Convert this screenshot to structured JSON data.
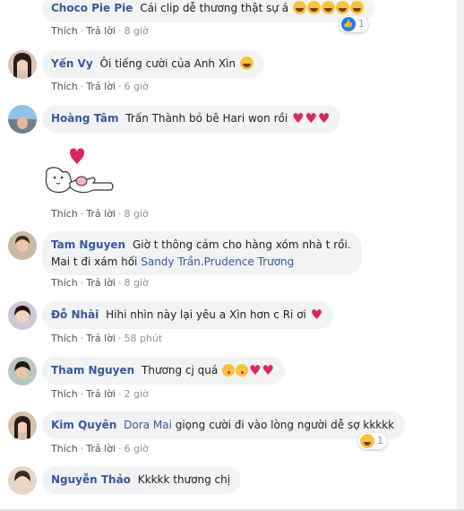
{
  "colors": {
    "name": "#385898",
    "meta": "#90949c",
    "bubble": "#f2f3f5",
    "heart": "#e0245e"
  },
  "actions": {
    "like": "Thích",
    "reply": "Trả lời"
  },
  "comments": [
    {
      "name": "Choco Pie Pie",
      "text": "Cái clip dễ thương thật sự á",
      "emoji": [
        "rofl",
        "rofl",
        "rofl",
        "rofl",
        "rofl"
      ],
      "time": "8 giờ",
      "reaction": {
        "icon": "like-icon",
        "count": "1"
      }
    },
    {
      "name": "Yến Vy",
      "text": "Ôi tiếng cười của Anh Xìn",
      "emoji": [
        "rofl"
      ],
      "time": "6 giờ"
    },
    {
      "name": "Hoàng Tâm",
      "text": "Trấn Thành bỏ bê Hari won rồi",
      "emoji": [
        "heart",
        "heart",
        "heart"
      ],
      "time": "8 giờ"
    },
    {
      "sticker": "heart-finger-sticker",
      "time": "8 giờ"
    },
    {
      "name": "Tam Nguyen",
      "text": "Giờ t thông cảm cho hàng xóm nhà t rồi.",
      "line2_text": "Mai t đi xám hối",
      "tags": [
        "Sandy Trần",
        "Prudence Trương"
      ],
      "time": "8 giờ"
    },
    {
      "name": "Đỗ Nhài",
      "text": "Hihi nhìn này lại yêu a Xìn hơn c Ri ơi",
      "emoji": [
        "heart"
      ],
      "time": "58 phút"
    },
    {
      "name": "Tham Nguyen",
      "text": "Thương cj quá",
      "emoji": [
        "kiss",
        "kiss",
        "heart",
        "heart"
      ],
      "time": "2 giờ"
    },
    {
      "name": "Kim Quyên",
      "tag": "Dora Mai",
      "text": "giọng cười đi vào lòng người dễ sợ kkkkk",
      "time": "6 giờ",
      "reaction": {
        "icon": "haha-icon",
        "count": "1"
      }
    },
    {
      "name": "Nguyễn Thảo",
      "text": "Kkkkk thương chị"
    }
  ]
}
